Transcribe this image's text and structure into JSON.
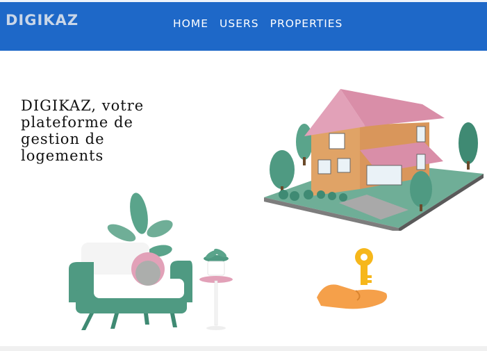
{
  "navbar": {
    "brand": "DIGIKAZ",
    "links": [
      "HOME",
      "USERS",
      "PROPERTIES"
    ]
  },
  "hero": {
    "headline": "DIGIKAZ, votre plateforme de gestion de logements"
  },
  "colors": {
    "navbar": "#1e68c8",
    "brand": "#c9d6e8",
    "roof": "#e2a1b8",
    "wall": "#e0a366",
    "green": "#4f9a82",
    "key": "#f6b71b",
    "hand": "#f5a04a"
  },
  "icons": [
    "house-illustration",
    "armchair-illustration",
    "plant-illustration",
    "key-hand-illustration"
  ]
}
